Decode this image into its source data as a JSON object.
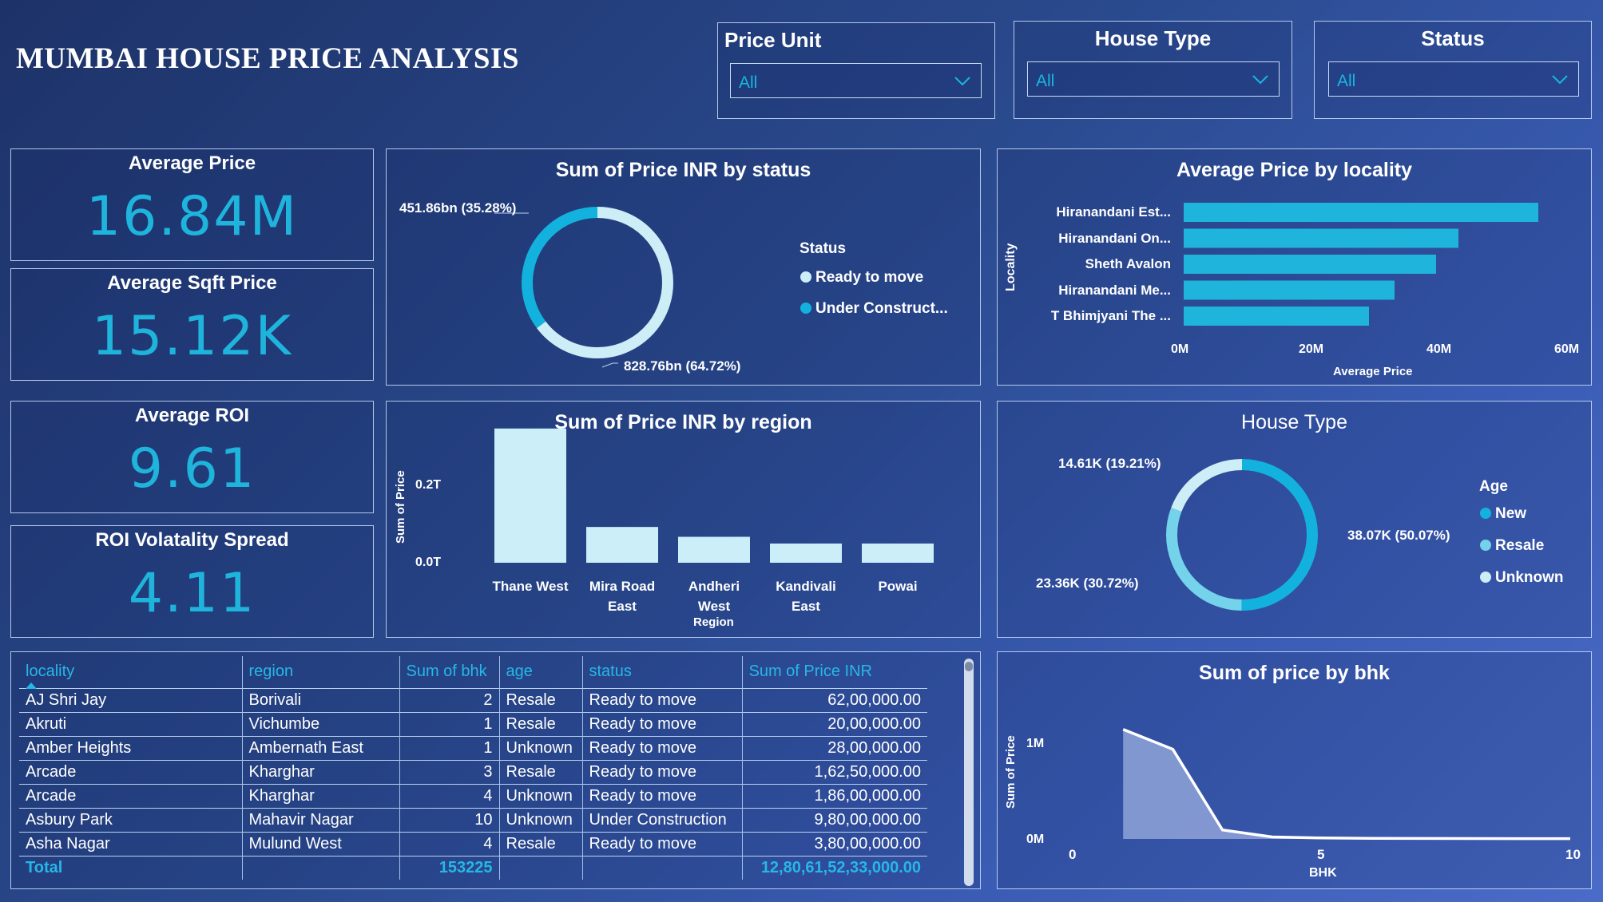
{
  "header": {
    "title": "MUMBAI HOUSE PRICE ANALYSIS"
  },
  "slicers": [
    {
      "label": "Price Unit",
      "value": "All"
    },
    {
      "label": "House Type",
      "value": "All"
    },
    {
      "label": "Status",
      "value": "All"
    }
  ],
  "kpis": [
    {
      "label": "Average Price",
      "value": "16.84M"
    },
    {
      "label": "Average Sqft Price",
      "value": "15.12K"
    },
    {
      "label": "Average ROI",
      "value": "9.61"
    },
    {
      "label": "ROI Volatality Spread",
      "value": "4.11"
    }
  ],
  "status_chart": {
    "title": "Sum of Price INR by status",
    "label_top": "451.86bn (35.28%)",
    "label_bottom": "828.76bn (64.72%)",
    "legend_title": "Status",
    "legend": [
      "Ready to move",
      "Under Construct..."
    ]
  },
  "locality_chart": {
    "title": "Average Price by locality",
    "ylabel": "Locality",
    "xlabel": "Average Price",
    "ticks": [
      "0M",
      "20M",
      "40M",
      "60M"
    ]
  },
  "region_chart": {
    "title": "Sum of Price INR by region",
    "ylabel": "Sum of Price",
    "xlabel": "Region",
    "ticks": [
      "0.2T",
      "0.0T"
    ],
    "category_lines": [
      [
        "Thane West"
      ],
      [
        "Mira Road",
        "East"
      ],
      [
        "Andheri",
        "West"
      ],
      [
        "Kandivali",
        "East"
      ],
      [
        "Powai"
      ]
    ]
  },
  "housetype_chart": {
    "title": "House Type",
    "label_left_top": "14.61K (19.21%)",
    "label_left_bottom": "23.36K (30.72%)",
    "label_right": "38.07K (50.07%)",
    "legend_title": "Age",
    "legend": [
      "New",
      "Resale",
      "Unknown"
    ]
  },
  "bhk_chart": {
    "title": "Sum of price by bhk",
    "ylabel": "Sum of Price",
    "xlabel": "BHK",
    "yticks": [
      "1M",
      "0M"
    ],
    "xticks": [
      "0",
      "5",
      "10"
    ]
  },
  "table": {
    "columns": [
      "locality",
      "region",
      "Sum of bhk",
      "age",
      "status",
      "Sum of Price INR"
    ],
    "rows": [
      [
        "AJ Shri Jay",
        "Borivali",
        "2",
        "Resale",
        "Ready to move",
        "62,00,000.00"
      ],
      [
        "Akruti",
        "Vichumbe",
        "1",
        "Resale",
        "Ready to move",
        "20,00,000.00"
      ],
      [
        "Amber Heights",
        "Ambernath East",
        "1",
        "Unknown",
        "Ready to move",
        "28,00,000.00"
      ],
      [
        "Arcade",
        "Kharghar",
        "3",
        "Resale",
        "Ready to move",
        "1,62,50,000.00"
      ],
      [
        "Arcade",
        "Kharghar",
        "4",
        "Unknown",
        "Ready to move",
        "1,86,00,000.00"
      ],
      [
        "Asbury Park",
        "Mahavir Nagar",
        "10",
        "Unknown",
        "Under Construction",
        "9,80,00,000.00"
      ],
      [
        "Asha Nagar",
        "Mulund West",
        "4",
        "Resale",
        "Ready to move",
        "3,80,00,000.00"
      ]
    ],
    "total": [
      "Total",
      "",
      "153225",
      "",
      "",
      "12,80,61,52,33,000.00"
    ]
  },
  "colors": {
    "accent": "#1fb4dc",
    "bar_light": "#cbeef8",
    "donut_light": "#cdeef7",
    "donut_dark": "#13b2de",
    "donut_mid": "#74d2ea",
    "area_fill": "#8fa3d8"
  },
  "chart_data": [
    {
      "type": "pie",
      "title": "Sum of Price INR by status",
      "categories": [
        "Ready to move",
        "Under Construct..."
      ],
      "values": [
        828.76,
        451.86
      ],
      "unit": "bn",
      "percentages": [
        64.72,
        35.28
      ]
    },
    {
      "type": "bar",
      "orientation": "horizontal",
      "title": "Average Price by locality",
      "categories": [
        "Hiranandani Est...",
        "Hiranandani On...",
        "Sheth Avalon",
        "Hiranandani Me...",
        "T Bhimjyani The ..."
      ],
      "values": [
        55500000,
        43000000,
        39500000,
        33000000,
        29000000
      ],
      "xlabel": "Average Price",
      "ylabel": "Locality",
      "xlim": [
        0,
        60000000
      ]
    },
    {
      "type": "bar",
      "title": "Sum of Price INR by region",
      "categories": [
        "Thane West",
        "Mira Road East",
        "Andheri West",
        "Kandivali East",
        "Powai"
      ],
      "values": [
        0.3,
        0.08,
        0.058,
        0.043,
        0.043
      ],
      "unit": "T",
      "xlabel": "Region",
      "ylabel": "Sum of Price",
      "ylim": [
        0,
        0.33
      ]
    },
    {
      "type": "pie",
      "title": "House Type",
      "categories": [
        "New",
        "Resale",
        "Unknown"
      ],
      "values": [
        38.07,
        23.36,
        14.61
      ],
      "unit": "K",
      "percentages": [
        50.07,
        30.72,
        19.21
      ]
    },
    {
      "type": "area",
      "title": "Sum of price by bhk",
      "x": [
        1,
        2,
        3,
        4,
        5,
        6,
        7,
        8,
        9,
        10
      ],
      "values": [
        1100000,
        900000,
        90000,
        20000,
        10000,
        6000,
        5000,
        4000,
        3000,
        3000
      ],
      "xlabel": "BHK",
      "ylabel": "Sum of Price",
      "xlim": [
        0,
        10
      ],
      "ylim": [
        0,
        1300000
      ]
    }
  ]
}
